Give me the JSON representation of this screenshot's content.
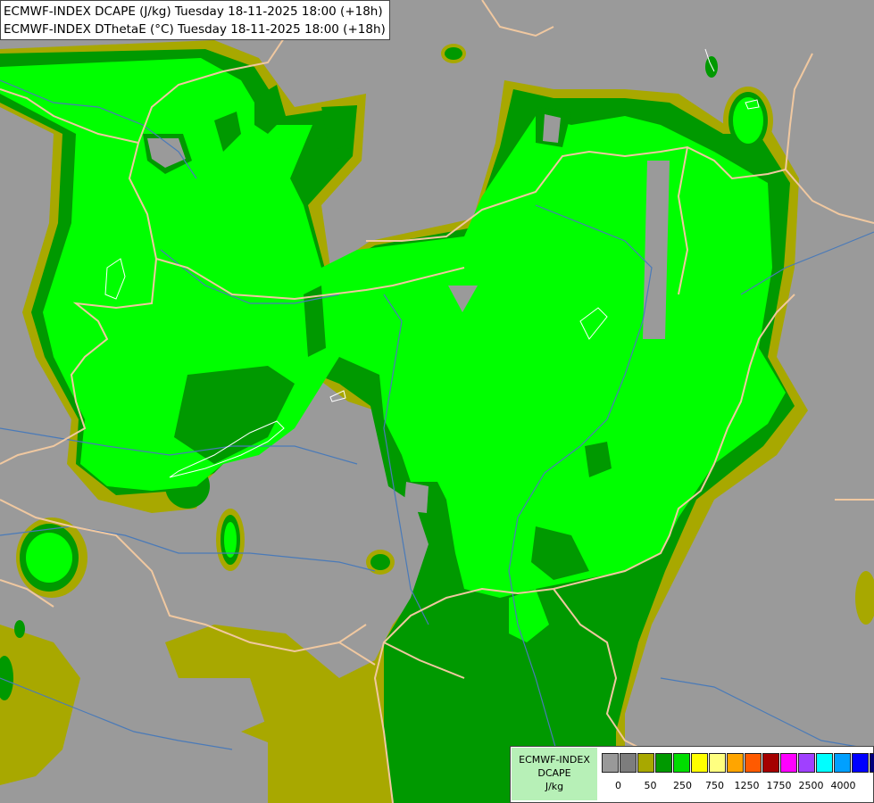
{
  "title": {
    "line1": "ECMWF-INDEX DCAPE (J/kg) Tuesday 18-11-2025 18:00 (+18h)",
    "line2": "ECMWF-INDEX DThetaE (°C) Tuesday 18-11-2025 18:00 (+18h)"
  },
  "legend": {
    "line1": "ECMWF-INDEX",
    "line2": "DCAPE",
    "line3": "J/kg",
    "colors": [
      "#999999",
      "#7d7d7d",
      "#a8a800",
      "#009900",
      "#00dd00",
      "#ffff00",
      "#ffff80",
      "#ffa500",
      "#ff5a00",
      "#a50000",
      "#ff00ff",
      "#a040ff",
      "#00ffff",
      "#00a0ff",
      "#0000ff",
      "#00007c"
    ],
    "ticks": [
      "0",
      "50",
      "250",
      "750",
      "1250",
      "1750",
      "2500",
      "4000"
    ]
  },
  "map_colors": {
    "background": "#9a9a9a",
    "olive": "#a8a800",
    "dark_green": "#009900",
    "bright_green": "#00ff00",
    "border": "#f0c8a0",
    "river": "#4a7ab8",
    "lake": "#ffffff"
  }
}
